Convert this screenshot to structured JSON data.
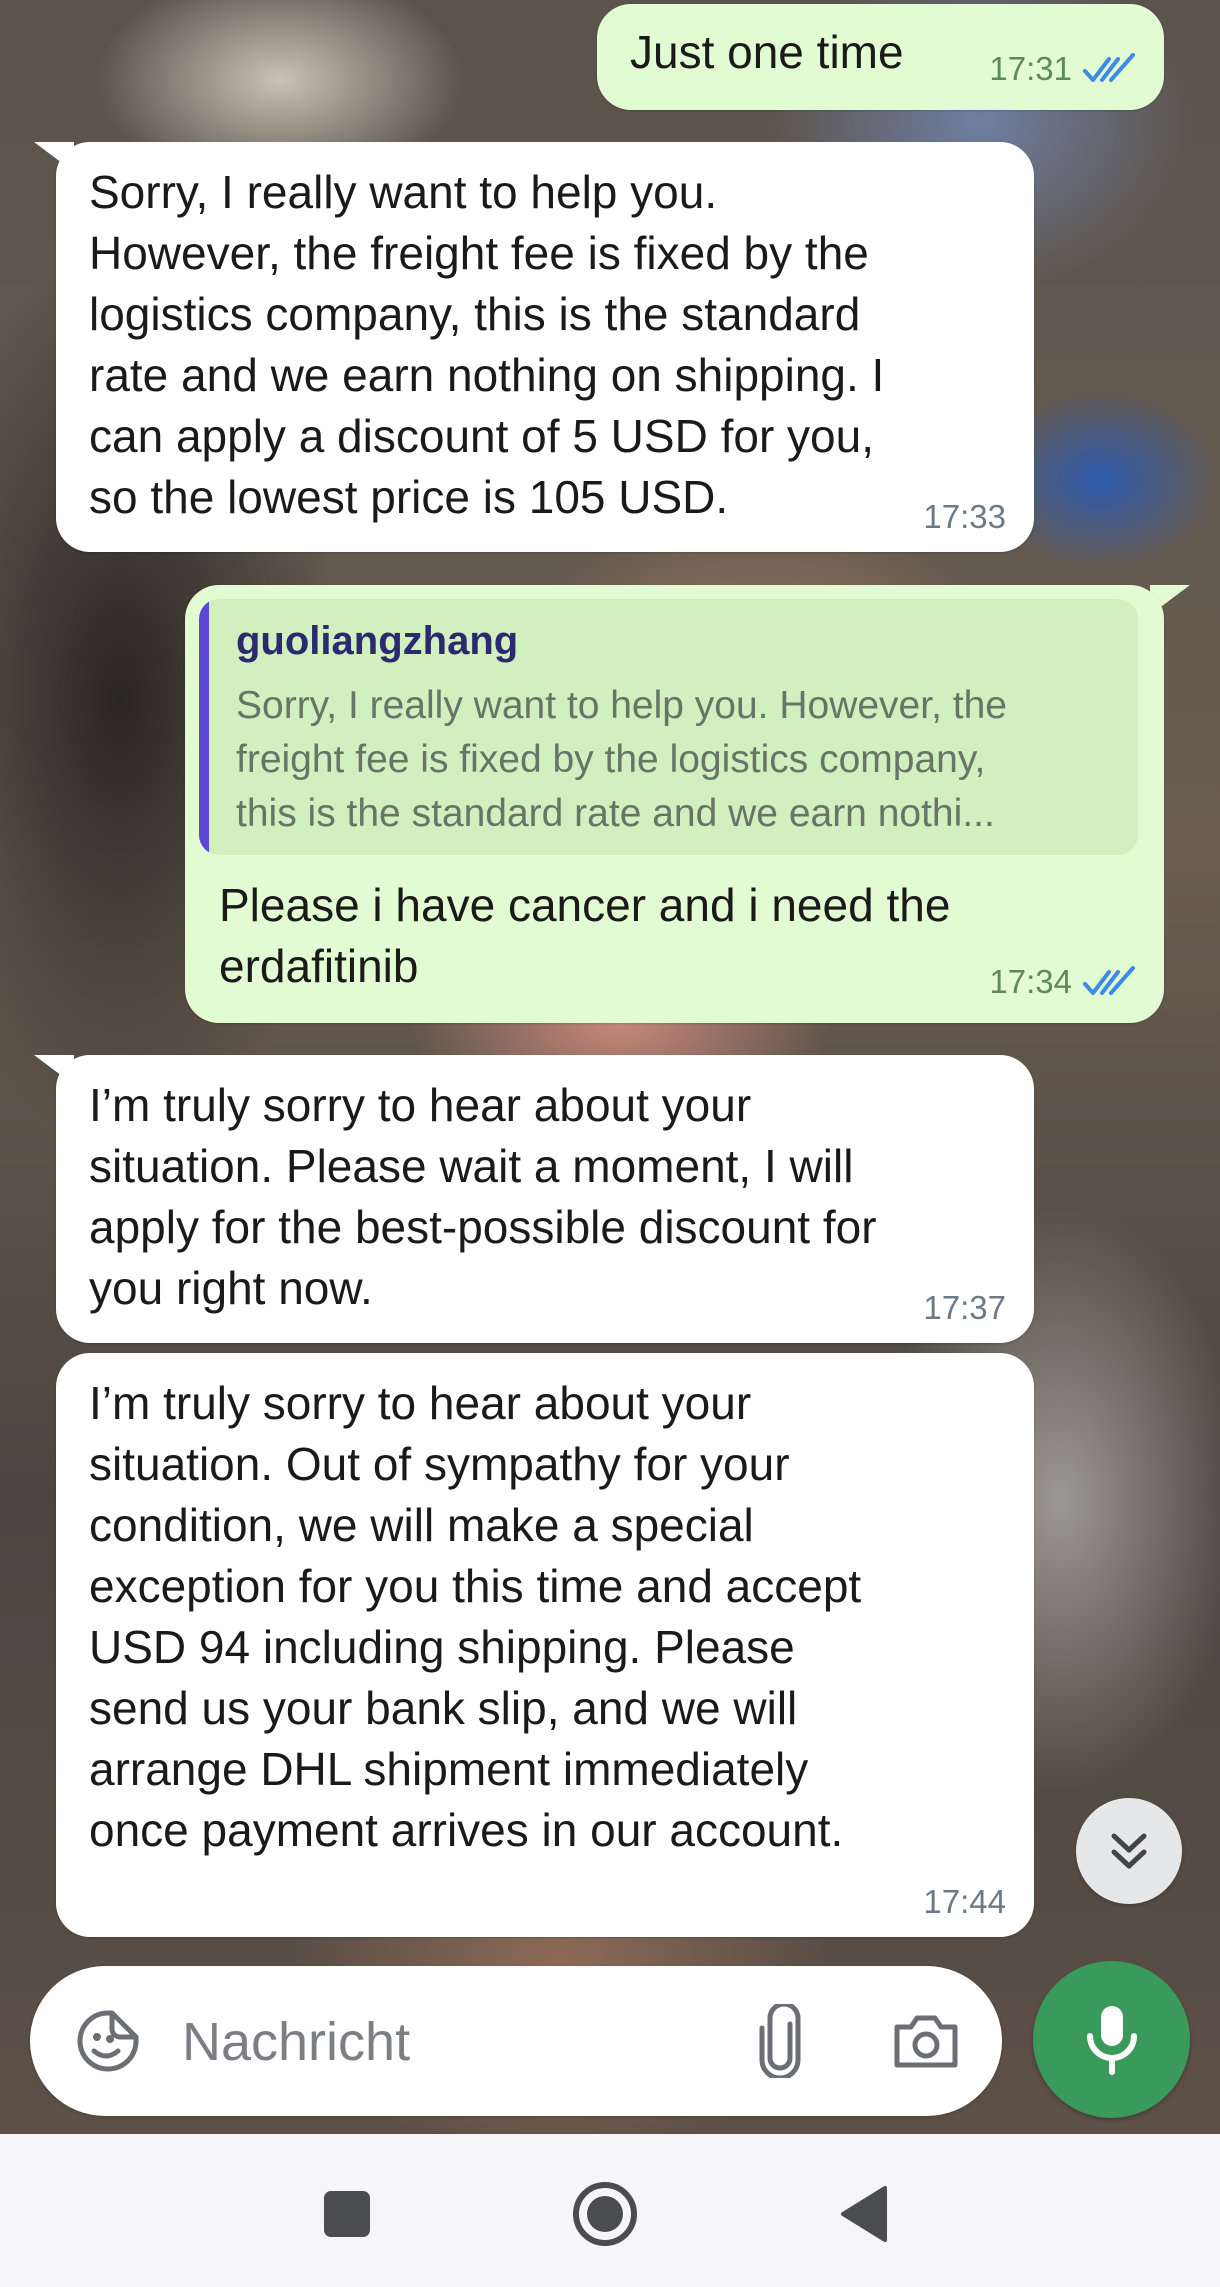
{
  "messages": [
    {
      "direction": "outgoing",
      "text": "Just one time",
      "time": "17:31",
      "status": "read"
    },
    {
      "direction": "incoming",
      "text": "Sorry, I really want to help you.\nHowever, the freight fee is fixed by the\nlogistics company, this is the standard\nrate and we earn nothing on shipping. I\ncan apply a discount of 5 USD for you,\nso the lowest price is 105 USD.",
      "time": "17:33"
    },
    {
      "direction": "outgoing",
      "reply_to": {
        "author": "guoliangzhang",
        "text": "Sorry, I really want to help you. However, the\nfreight fee is fixed by the logistics company,\nthis is the standard rate and we earn nothi..."
      },
      "text": "Please i have cancer and i need the\nerdafitinib",
      "time": "17:34",
      "status": "read"
    },
    {
      "direction": "incoming",
      "text": "I’m truly sorry to hear about your\nsituation. Please wait a moment, I will\napply for the best-possible discount for\nyou right now.",
      "time": "17:37"
    },
    {
      "direction": "incoming",
      "text": "I’m truly sorry to hear about your\nsituation. Out of sympathy for your\ncondition, we will make a special\nexception for you this time and accept\nUSD 94 including shipping. Please\nsend us your bank slip, and we will\narrange DHL shipment immediately\nonce payment arrives in our account.",
      "time": "17:44"
    }
  ],
  "composer": {
    "placeholder": "Nachricht",
    "value": ""
  },
  "icons": {
    "emoji": "sticker-smile-icon",
    "attach": "paperclip-icon",
    "camera": "camera-icon",
    "mic": "microphone-icon",
    "scroll": "double-chevron-down-icon",
    "nav_recents": "square-icon",
    "nav_home": "circle-icon",
    "nav_back": "triangle-back-icon"
  },
  "colors": {
    "outgoing_bubble": "#e3fbd2",
    "incoming_bubble": "#ffffff",
    "read_ticks": "#3d8be6",
    "reply_bar": "#5b49d6",
    "mic_button": "#3a9a5c"
  }
}
